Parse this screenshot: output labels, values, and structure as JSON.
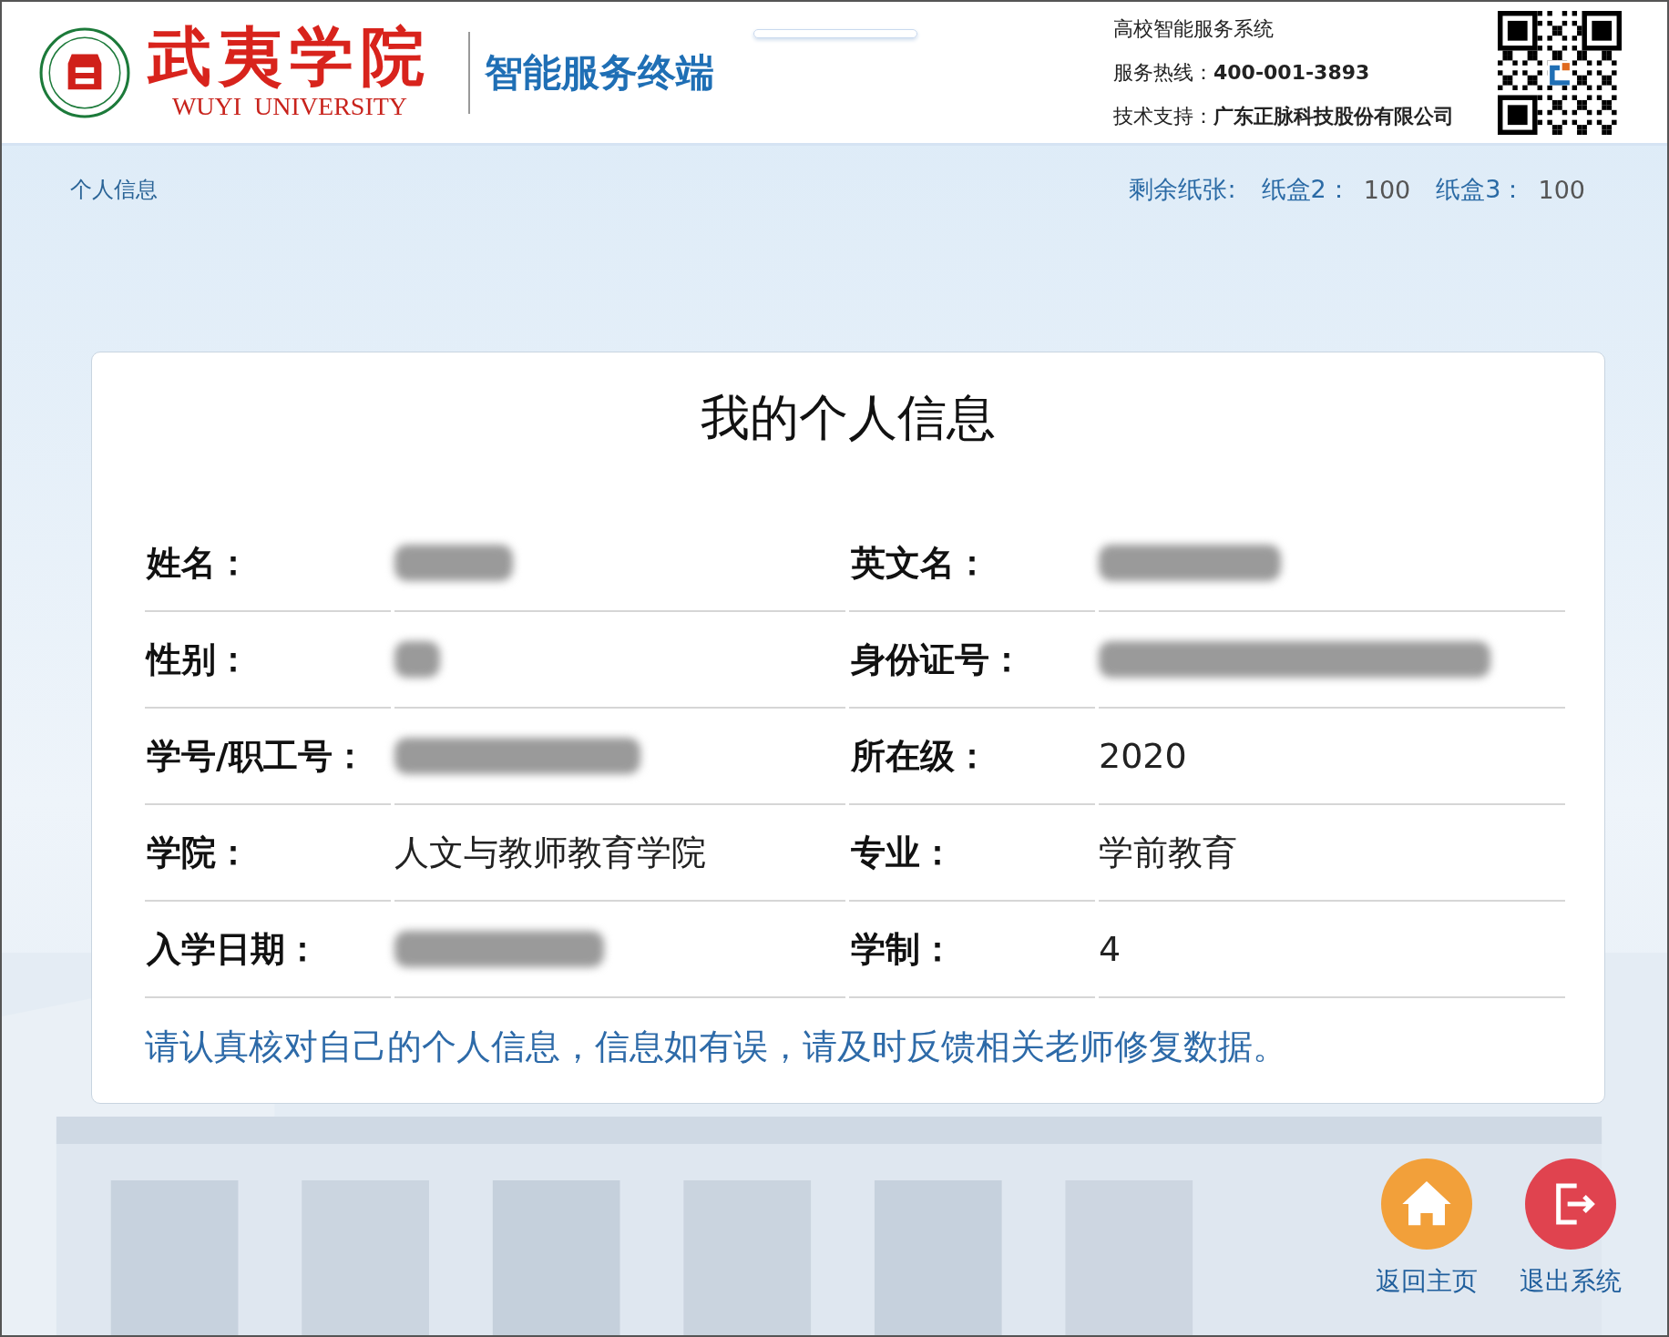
{
  "header": {
    "school_name": "武夷学院",
    "school_name_en": "WUYI  UNIVERSITY",
    "app_title": "智能服务终端",
    "info_lines": [
      {
        "label": "高校智能服务系统"
      },
      {
        "label": "服务热线：",
        "value": "400-001-3893"
      },
      {
        "label": "技术支持：",
        "value": "广东正脉科技股份有限公司"
      }
    ]
  },
  "breadcrumb": "个人信息",
  "paper": {
    "label": "剩余纸张:",
    "trays": [
      {
        "name": "纸盒2：",
        "count": "100"
      },
      {
        "name": "纸盒3：",
        "count": "100"
      }
    ]
  },
  "card": {
    "title": "我的个人信息",
    "rows": [
      [
        {
          "label": "姓名：",
          "kind": "redacted"
        },
        {
          "label": "英文名：",
          "kind": "redacted"
        }
      ],
      [
        {
          "label": "性别：",
          "kind": "redacted"
        },
        {
          "label": "身份证号：",
          "kind": "redacted"
        }
      ],
      [
        {
          "label": "学号/职工号：",
          "kind": "redacted"
        },
        {
          "label": "所在级：",
          "kind": "text",
          "value": "2020"
        }
      ],
      [
        {
          "label": "学院：",
          "kind": "text",
          "value": "人文与教师教育学院"
        },
        {
          "label": "专业：",
          "kind": "text",
          "value": "学前教育"
        }
      ],
      [
        {
          "label": "入学日期：",
          "kind": "redacted"
        },
        {
          "label": "学制：",
          "kind": "text",
          "value": "4"
        }
      ]
    ],
    "note": "请认真核对自己的个人信息，信息如有误，请及时反馈相关老师修复数据。"
  },
  "actions": [
    {
      "kind": "home",
      "label": "返回主页"
    },
    {
      "kind": "exit",
      "label": "退出系统"
    }
  ]
}
